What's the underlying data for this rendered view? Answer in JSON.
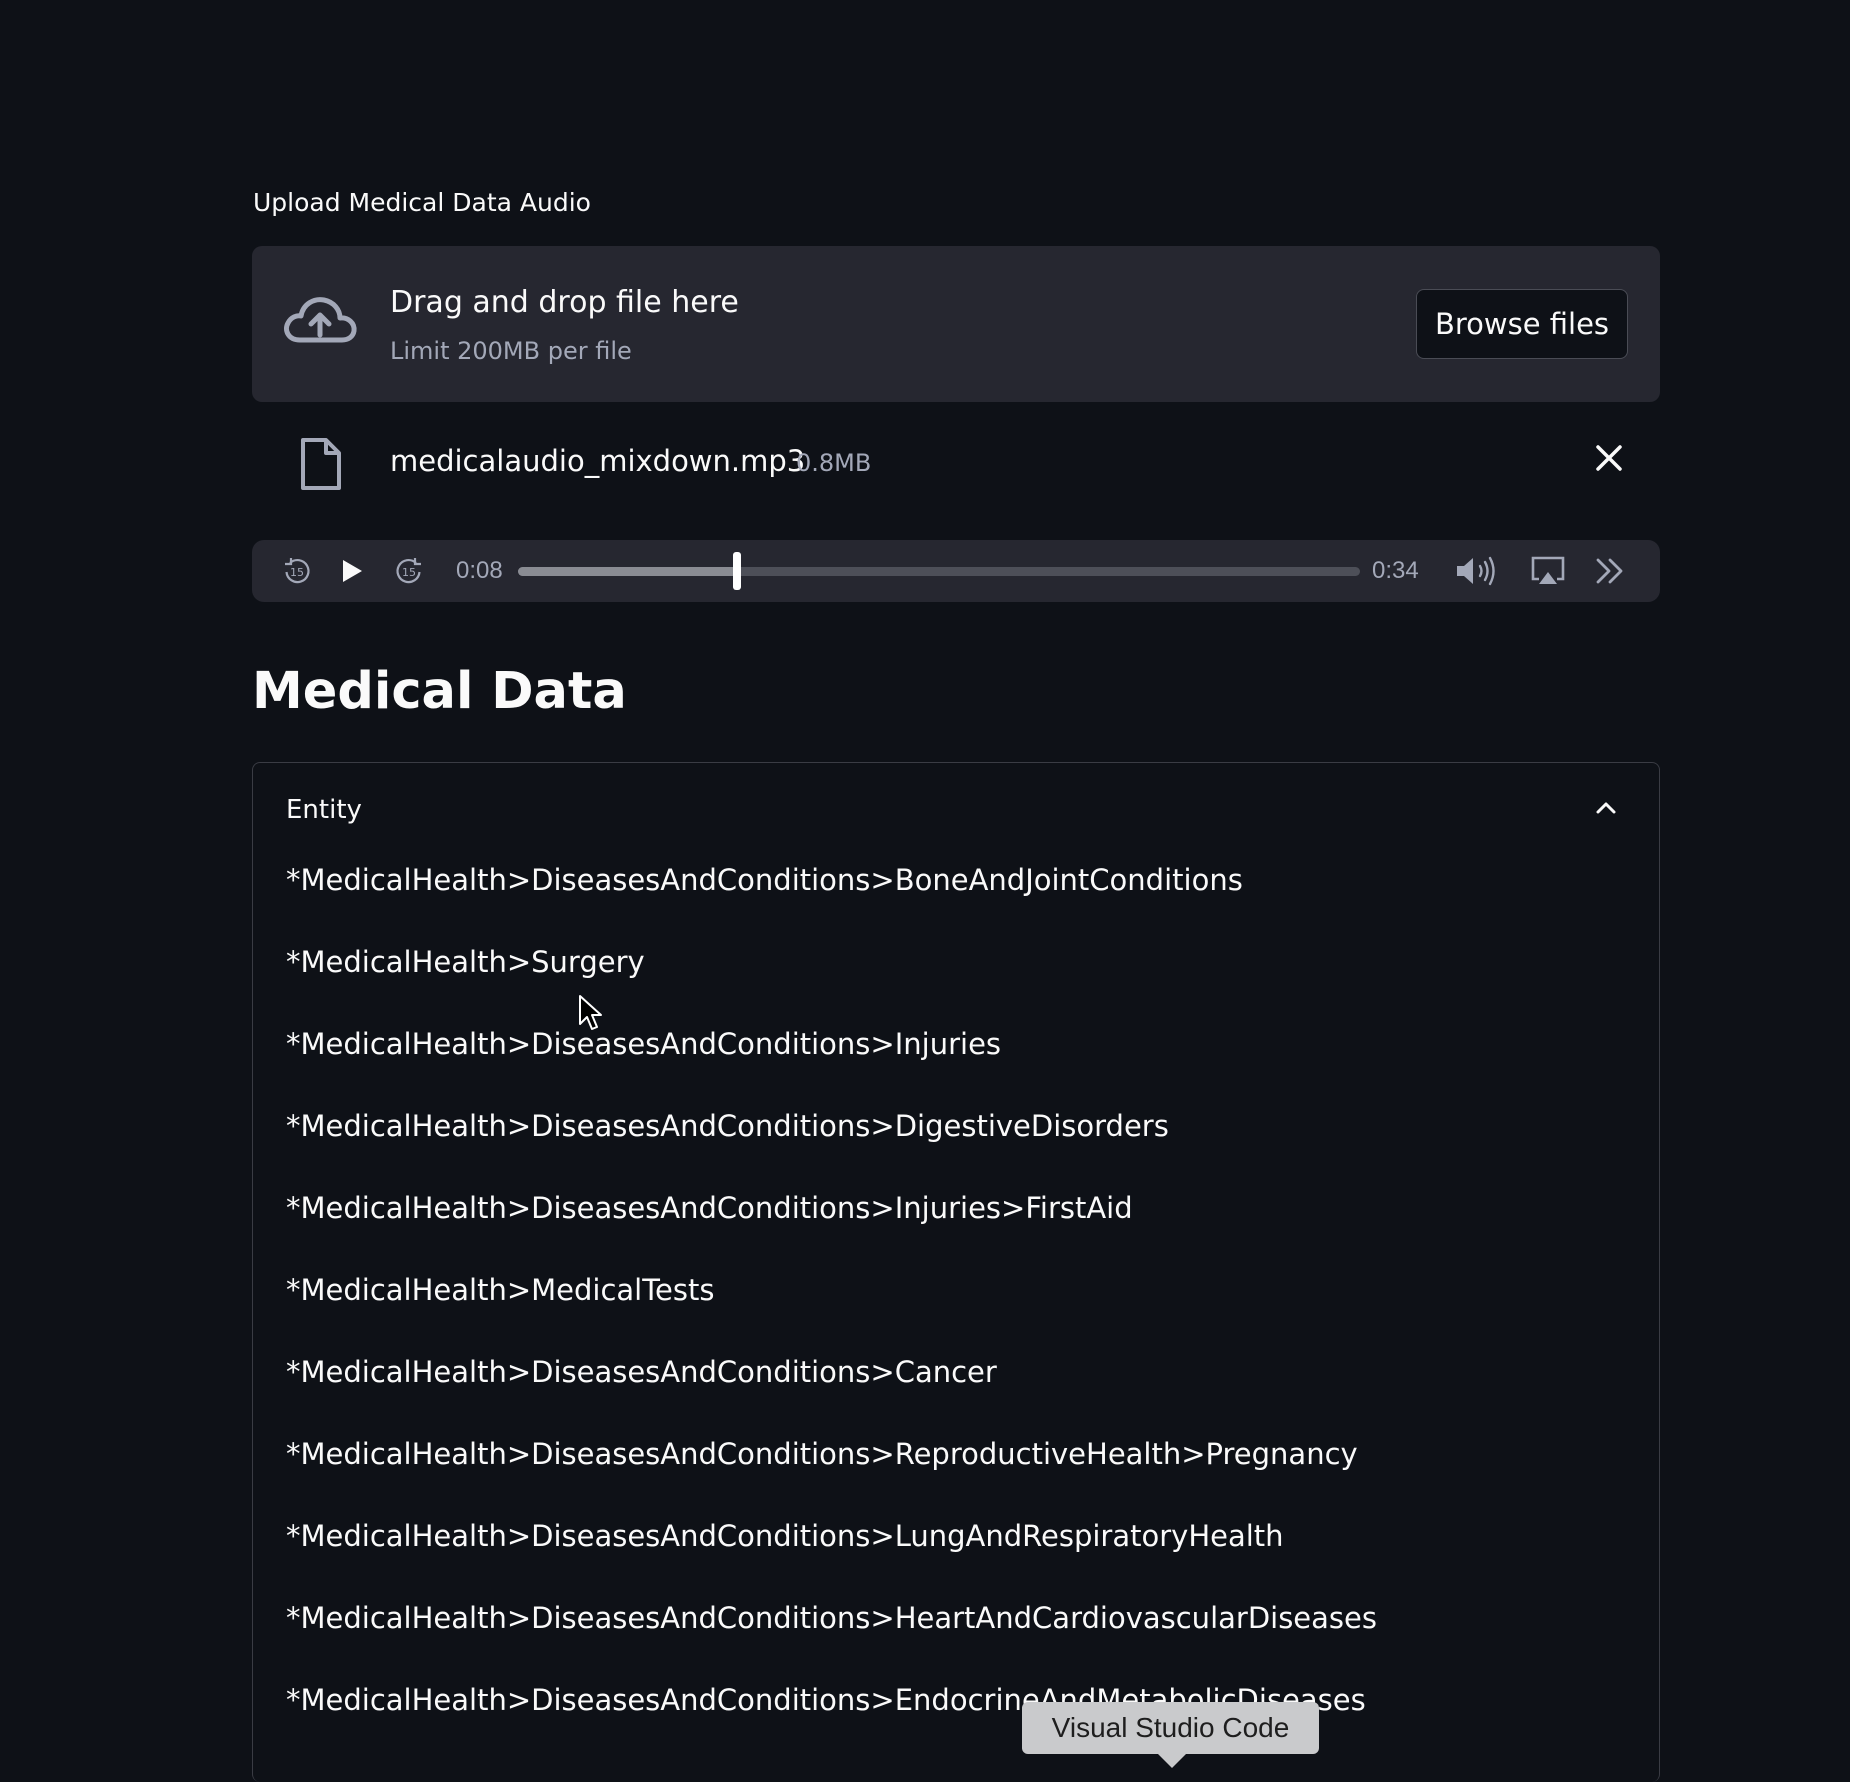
{
  "uploader": {
    "label": "Upload Medical Data Audio",
    "drop_title": "Drag and drop file here",
    "drop_limit": "Limit 200MB per file",
    "browse_label": "Browse files",
    "icon": "cloud-upload-icon"
  },
  "file": {
    "name": "medicalaudio_mixdown.mp3",
    "size": "0.8MB",
    "icon": "file-icon"
  },
  "player": {
    "current_time": "0:08",
    "duration": "0:34",
    "progress": 0.26
  },
  "section": {
    "heading": "Medical Data"
  },
  "expander": {
    "title": "Entity",
    "expanded": true,
    "items": [
      "*MedicalHealth>DiseasesAndConditions>BoneAndJointConditions",
      "*MedicalHealth>Surgery",
      "*MedicalHealth>DiseasesAndConditions>Injuries",
      "*MedicalHealth>DiseasesAndConditions>DigestiveDisorders",
      "*MedicalHealth>DiseasesAndConditions>Injuries>FirstAid",
      "*MedicalHealth>MedicalTests",
      "*MedicalHealth>DiseasesAndConditions>Cancer",
      "*MedicalHealth>DiseasesAndConditions>ReproductiveHealth>Pregnancy",
      "*MedicalHealth>DiseasesAndConditions>LungAndRespiratoryHealth",
      "*MedicalHealth>DiseasesAndConditions>HeartAndCardiovascularDiseases",
      "*MedicalHealth>DiseasesAndConditions>EndocrineAndMetabolicDiseases"
    ]
  },
  "tooltip": {
    "text": "Visual Studio Code"
  },
  "colors": {
    "background": "#0e1117",
    "panel": "#262730",
    "text": "#fafafa",
    "muted": "#a3a8b8"
  }
}
